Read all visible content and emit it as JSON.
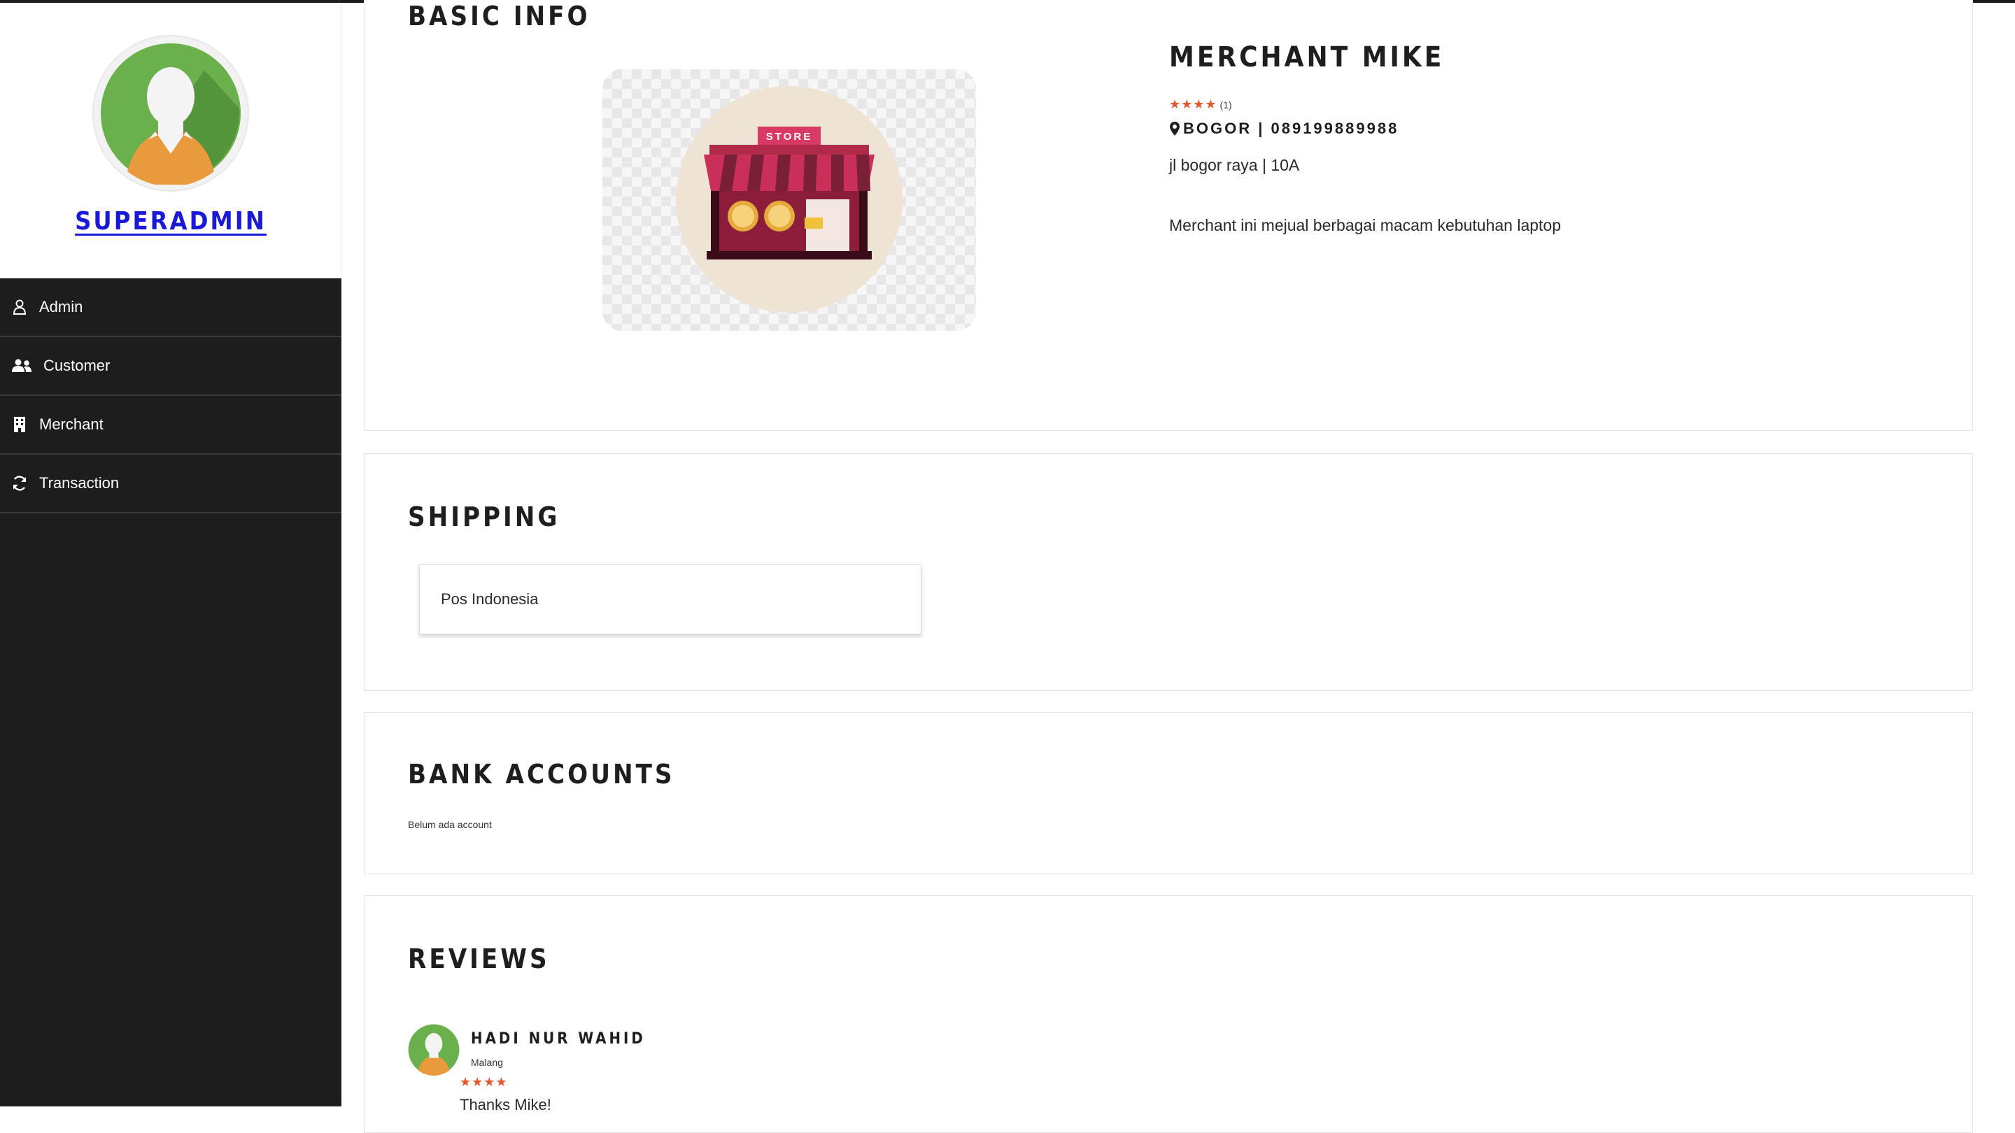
{
  "sidebar": {
    "profile_name": "SUPERADMIN",
    "items": [
      {
        "label": "Admin",
        "icon": "user-icon"
      },
      {
        "label": "Customer",
        "icon": "users-icon"
      },
      {
        "label": "Merchant",
        "icon": "building-icon"
      },
      {
        "label": "Transaction",
        "icon": "refresh-icon"
      }
    ]
  },
  "basic_info": {
    "title": "BASIC INFO",
    "store_sign": "STORE",
    "merchant_name": "MERCHANT MIKE",
    "rating": {
      "stars": "★★★★",
      "count": "(1)",
      "value": 4
    },
    "location": "BOGOR | 089199889988",
    "address": "jl bogor raya | 10A",
    "description": "Merchant ini mejual berbagai macam kebutuhan laptop"
  },
  "shipping": {
    "title": "SHIPPING",
    "items": [
      "Pos Indonesia"
    ]
  },
  "bank_accounts": {
    "title": "BANK ACCOUNTS",
    "empty_text": "Belum ada account"
  },
  "reviews": {
    "title": "REVIEWS",
    "items": [
      {
        "name": "HADI NUR WAHID",
        "city": "Malang",
        "stars": "★★★★",
        "rating": 4,
        "text": "Thanks Mike!"
      }
    ]
  },
  "colors": {
    "sidebar_bg": "#1d1d1d",
    "link_blue": "#1a1ad6",
    "star_orange": "#e2572c",
    "avatar_green": "#6ab04c"
  }
}
